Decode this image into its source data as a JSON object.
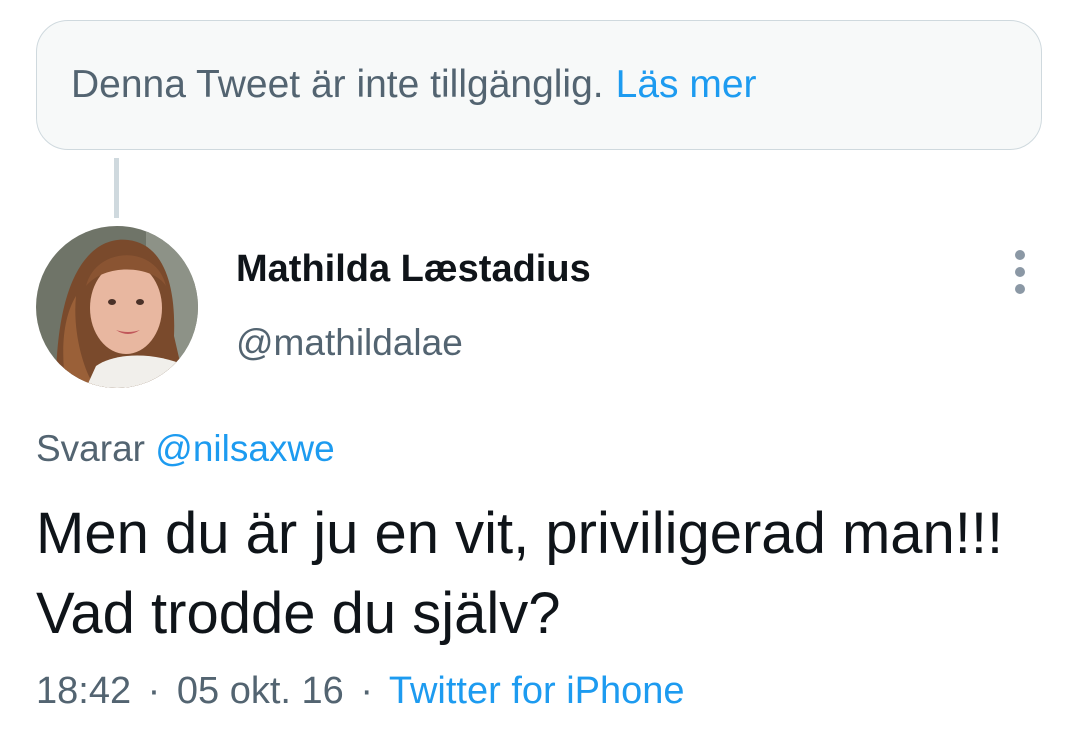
{
  "quoted": {
    "unavailable_text": "Denna Tweet är inte tillgänglig.",
    "read_more_link": "Läs mer"
  },
  "author": {
    "display_name": "Mathilda Læstadius",
    "handle": "@mathildalae",
    "avatar_icon": "profile-photo"
  },
  "reply": {
    "prefix": "Svarar",
    "mention": "@nilsaxwe"
  },
  "tweet": {
    "text": "Men du är ju en vit, priviligerad man!!! Vad trodde du själv?"
  },
  "meta": {
    "time": "18:42",
    "separator": "·",
    "date": "05 okt. 16",
    "source": "Twitter for iPhone"
  },
  "colors": {
    "accent": "#1d9bf0",
    "secondary_text": "#536471",
    "primary_text": "#0f1419",
    "box_background": "#f7f9f9",
    "border": "#cfd9de"
  }
}
